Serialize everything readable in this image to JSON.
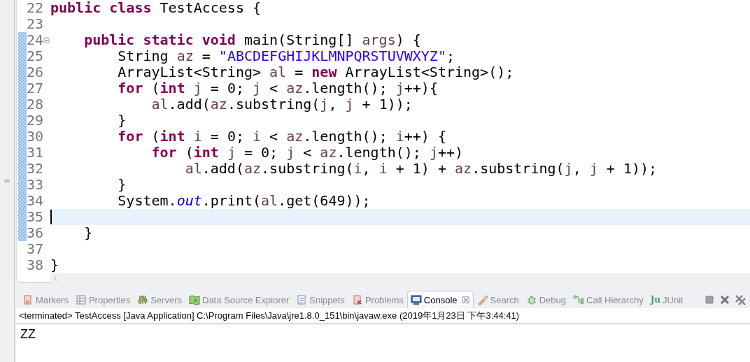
{
  "editor": {
    "lines": [
      {
        "number": "22",
        "tokens": [
          {
            "kind": "keyword",
            "text": "public class"
          },
          {
            "kind": "plain",
            "text": " TestAccess {"
          }
        ]
      },
      {
        "number": "23"
      },
      {
        "number": "24",
        "fold": true,
        "changed": true,
        "tokens": [
          {
            "kind": "keyword",
            "text": "    public static void"
          },
          {
            "kind": "plain",
            "text": " main(String[] "
          },
          {
            "kind": "variable",
            "text": "args"
          },
          {
            "kind": "plain",
            "text": ") {"
          }
        ]
      },
      {
        "number": "25",
        "changed": true,
        "tokens": [
          {
            "kind": "plain",
            "text": "        String "
          },
          {
            "kind": "variable",
            "text": "az"
          },
          {
            "kind": "plain",
            "text": " = "
          },
          {
            "kind": "string",
            "text": "\"ABCDEFGHIJKLMNPQRSTUVWXYZ\""
          },
          {
            "kind": "plain",
            "text": ";"
          }
        ]
      },
      {
        "number": "26",
        "changed": true,
        "tokens": [
          {
            "kind": "plain",
            "text": "        ArrayList<String> "
          },
          {
            "kind": "variable",
            "text": "al"
          },
          {
            "kind": "plain",
            "text": " = "
          },
          {
            "kind": "keyword",
            "text": "new"
          },
          {
            "kind": "plain",
            "text": " ArrayList<String>();"
          }
        ]
      },
      {
        "number": "27",
        "changed": true,
        "tokens": [
          {
            "kind": "keyword",
            "text": "        for"
          },
          {
            "kind": "plain",
            "text": " ("
          },
          {
            "kind": "keyword",
            "text": "int"
          },
          {
            "kind": "variable",
            "text": " j"
          },
          {
            "kind": "plain",
            "text": " = 0; "
          },
          {
            "kind": "variable",
            "text": "j"
          },
          {
            "kind": "plain",
            "text": " < "
          },
          {
            "kind": "variable",
            "text": "az"
          },
          {
            "kind": "plain",
            "text": ".length(); "
          },
          {
            "kind": "variable",
            "text": "j"
          },
          {
            "kind": "plain",
            "text": "++){"
          }
        ]
      },
      {
        "number": "28",
        "changed": true,
        "tokens": [
          {
            "kind": "variable",
            "text": "            al"
          },
          {
            "kind": "plain",
            "text": ".add("
          },
          {
            "kind": "variable",
            "text": "az"
          },
          {
            "kind": "plain",
            "text": ".substring("
          },
          {
            "kind": "variable",
            "text": "j"
          },
          {
            "kind": "plain",
            "text": ", "
          },
          {
            "kind": "variable",
            "text": "j"
          },
          {
            "kind": "plain",
            "text": " + 1));"
          }
        ]
      },
      {
        "number": "29",
        "changed": true,
        "tokens": [
          {
            "kind": "plain",
            "text": "        }"
          }
        ]
      },
      {
        "number": "30",
        "changed": true,
        "tokens": [
          {
            "kind": "keyword",
            "text": "        for"
          },
          {
            "kind": "plain",
            "text": " ("
          },
          {
            "kind": "keyword",
            "text": "int"
          },
          {
            "kind": "variable",
            "text": " i"
          },
          {
            "kind": "plain",
            "text": " = 0; "
          },
          {
            "kind": "variable",
            "text": "i"
          },
          {
            "kind": "plain",
            "text": " < "
          },
          {
            "kind": "variable",
            "text": "az"
          },
          {
            "kind": "plain",
            "text": ".length(); "
          },
          {
            "kind": "variable",
            "text": "i"
          },
          {
            "kind": "plain",
            "text": "++) {"
          }
        ]
      },
      {
        "number": "31",
        "changed": true,
        "tokens": [
          {
            "kind": "keyword",
            "text": "            for"
          },
          {
            "kind": "plain",
            "text": " ("
          },
          {
            "kind": "keyword",
            "text": "int"
          },
          {
            "kind": "variable",
            "text": " j"
          },
          {
            "kind": "plain",
            "text": " = 0; "
          },
          {
            "kind": "variable",
            "text": "j"
          },
          {
            "kind": "plain",
            "text": " < "
          },
          {
            "kind": "variable",
            "text": "az"
          },
          {
            "kind": "plain",
            "text": ".length(); "
          },
          {
            "kind": "variable",
            "text": "j"
          },
          {
            "kind": "plain",
            "text": "++)"
          }
        ]
      },
      {
        "number": "32",
        "changed": true,
        "tokens": [
          {
            "kind": "variable",
            "text": "                al"
          },
          {
            "kind": "plain",
            "text": ".add("
          },
          {
            "kind": "variable",
            "text": "az"
          },
          {
            "kind": "plain",
            "text": ".substring("
          },
          {
            "kind": "variable",
            "text": "i"
          },
          {
            "kind": "plain",
            "text": ", "
          },
          {
            "kind": "variable",
            "text": "i"
          },
          {
            "kind": "plain",
            "text": " + 1) + "
          },
          {
            "kind": "variable",
            "text": "az"
          },
          {
            "kind": "plain",
            "text": ".substring("
          },
          {
            "kind": "variable",
            "text": "j"
          },
          {
            "kind": "plain",
            "text": ", "
          },
          {
            "kind": "variable",
            "text": "j"
          },
          {
            "kind": "plain",
            "text": " + 1));"
          }
        ]
      },
      {
        "number": "33",
        "changed": true,
        "tokens": [
          {
            "kind": "plain",
            "text": "        }"
          }
        ]
      },
      {
        "number": "34",
        "changed": true,
        "tokens": [
          {
            "kind": "plain",
            "text": "        System."
          },
          {
            "kind": "field",
            "text": "out"
          },
          {
            "kind": "plain",
            "text": ".print("
          },
          {
            "kind": "variable",
            "text": "al"
          },
          {
            "kind": "plain",
            "text": ".get(649));"
          }
        ]
      },
      {
        "number": "35",
        "changed": true,
        "current": true
      },
      {
        "number": "36",
        "changed": true,
        "tokens": [
          {
            "kind": "plain",
            "text": "    }"
          }
        ]
      },
      {
        "number": "37"
      },
      {
        "number": "38",
        "tokens": [
          {
            "kind": "plain",
            "text": "}"
          }
        ]
      }
    ]
  },
  "panel": {
    "tabs": [
      {
        "kind": "markers",
        "label": "Markers",
        "selected": false
      },
      {
        "kind": "properties",
        "label": "Properties",
        "selected": false
      },
      {
        "kind": "servers",
        "label": "Servers",
        "selected": false
      },
      {
        "kind": "datasource",
        "label": "Data Source Explorer",
        "selected": false
      },
      {
        "kind": "snippets",
        "label": "Snippets",
        "selected": false
      },
      {
        "kind": "problems",
        "label": "Problems",
        "selected": false
      },
      {
        "kind": "console",
        "label": "Console",
        "selected": true,
        "close": "☒"
      },
      {
        "kind": "search",
        "label": "Search",
        "selected": false
      },
      {
        "kind": "debug",
        "label": "Debug",
        "selected": false
      },
      {
        "kind": "hierarchy",
        "label": "Call Hierarchy",
        "selected": false
      },
      {
        "kind": "junit",
        "label": "JUnit",
        "selected": false,
        "icon_text": "Ju"
      }
    ],
    "header": "<terminated> TestAccess [Java Application] C:\\Program Files\\Java\\jre1.8.0_151\\bin\\javaw.exe (2019年1月23日 下午3:44:41)",
    "output": "ZZ"
  }
}
